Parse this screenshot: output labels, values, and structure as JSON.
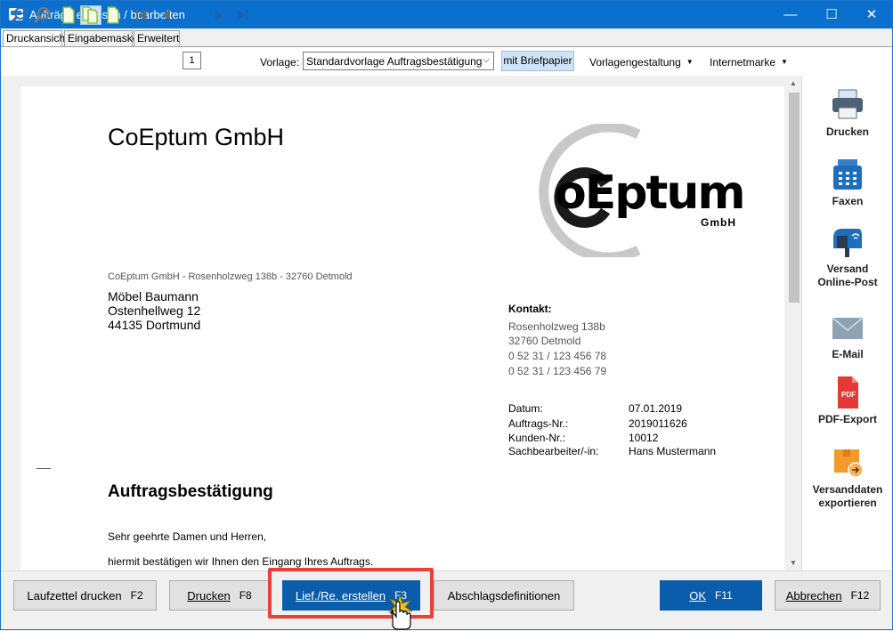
{
  "window": {
    "title": "Aufträge erfassen / bearbeiten",
    "minimize": "—",
    "maximize": "☐",
    "close": "✕"
  },
  "tabs": [
    {
      "label": "Druckansicht",
      "active": true
    },
    {
      "label": "Eingabemaske",
      "active": false
    },
    {
      "label": "Erweitert",
      "active": false
    }
  ],
  "toolbar": {
    "page_number": "1",
    "vorlage_label": "Vorlage:",
    "vorlage_value": "Standardvorlage Auftragsbestätigung",
    "briefpapier": "mit Briefpapier",
    "vorlagengestaltung": "Vorlagengestaltung",
    "internetmarke": "Internetmarke"
  },
  "document": {
    "company_name": "CoEptum GmbH",
    "logo_text": "oEptum",
    "logo_sub": "GmbH",
    "sender_line": "CoEptum GmbH - Rosenholzweg 138b - 32760 Detmold",
    "recipient": [
      "Möbel Baumann",
      "Ostenhellweg 12",
      "44135 Dortmund"
    ],
    "contact_heading": "Kontakt:",
    "contact_lines": [
      "Rosenholzweg 138b",
      "32760 Detmold",
      "0 52 31 / 123 456 78",
      "0 52 31 / 123 456 79"
    ],
    "meta": [
      {
        "label": "Datum:",
        "value": "07.01.2019"
      },
      {
        "label": "Auftrags-Nr.:",
        "value": "2019011626"
      },
      {
        "label": "Kunden-Nr.:",
        "value": "10012"
      },
      {
        "label": "Sachbearbeiter/-in:",
        "value": "Hans Mustermann"
      }
    ],
    "heading": "Auftragsbestätigung",
    "salutation": "Sehr geehrte Damen und Herren,",
    "body_line": "hiermit bestätigen wir Ihnen den Eingang Ihres Auftrags."
  },
  "side_panel": [
    {
      "label": "Drucken",
      "icon": "printer-icon"
    },
    {
      "label": "Faxen",
      "icon": "fax-icon"
    },
    {
      "label": "Versand\nOnline-Post",
      "line1": "Versand",
      "line2": "Online-Post",
      "icon": "mailbox-icon"
    },
    {
      "label": "E-Mail",
      "icon": "envelope-icon"
    },
    {
      "label": "PDF-Export",
      "icon": "pdf-icon"
    },
    {
      "label": "Versanddaten exportieren",
      "line1": "Versanddaten",
      "line2": "exportieren",
      "icon": "box-export-icon"
    }
  ],
  "buttons": {
    "laufzettel": {
      "label": "Laufzettel drucken",
      "key": "F2"
    },
    "drucken": {
      "label": "Drucken",
      "key": "F8"
    },
    "liefre": {
      "label": "Lief./Re. erstellen",
      "key": "F3"
    },
    "abschlag": {
      "label": "Abschlagsdefinitionen"
    },
    "ok": {
      "label": "OK",
      "key": "F11"
    },
    "abbrechen": {
      "label": "Abbrechen",
      "key": "F12"
    }
  },
  "colors": {
    "titlebar": "#0b6fce",
    "highlight": "#e8403a",
    "primary_button": "#0b5cab"
  }
}
